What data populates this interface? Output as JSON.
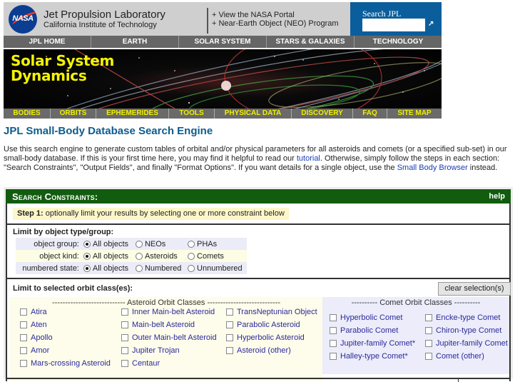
{
  "header": {
    "logo": "NASA",
    "lab_name": "Jet Propulsion Laboratory",
    "lab_sub": "California Institute of Technology",
    "links": [
      "+ View the NASA Portal",
      "+ Near-Earth Object (NEO) Program"
    ],
    "search_label": "Search JPL",
    "search_value": "",
    "search_go_icon": "arrow-go-icon"
  },
  "top_nav": [
    "JPL HOME",
    "EARTH",
    "SOLAR SYSTEM",
    "STARS & GALAXIES",
    "TECHNOLOGY"
  ],
  "banner": {
    "title_line1": "Solar System",
    "title_line2": "Dynamics"
  },
  "sub_nav": [
    "BODIES",
    "ORBITS",
    "EPHEMERIDES",
    "TOOLS",
    "PHYSICAL DATA",
    "DISCOVERY",
    "FAQ",
    "SITE MAP"
  ],
  "page_title": "JPL Small-Body Database Search Engine",
  "intro": {
    "part1": "Use this search engine to generate custom tables of orbital and/or physical parameters for all asteroids and comets (or a specified sub-set) in our small-body database. If this is your first time here, you may find it helpful to read our ",
    "link1": "tutorial",
    "part2": ". Otherwise, simply follow the steps in each section: \"Search Constraints\", \"Output Fields\", and finally \"Format Options\". If you want details for a single object, use the ",
    "link2": "Small Body Browser",
    "part3": " instead."
  },
  "constraints": {
    "title": "Search Constraints:",
    "help": "help",
    "step_label": "Step 1:",
    "step_text": " optionally limit your results by selecting one or more constraint below",
    "group_section": "Limit by object type/group:",
    "groups": [
      {
        "label": "object group:",
        "options": [
          "All objects",
          "NEOs",
          "PHAs"
        ],
        "selected": 0
      },
      {
        "label": "object kind:",
        "options": [
          "All objects",
          "Asteroids",
          "Comets"
        ],
        "selected": 0
      },
      {
        "label": "numbered state:",
        "options": [
          "All objects",
          "Numbered",
          "Unnumbered"
        ],
        "selected": 0
      }
    ],
    "orbit_section": "Limit to selected orbit class(es):",
    "clear_button": "clear selection(s)",
    "asteroid_header": "---------------------------- Asteroid Orbit Classes ----------------------------",
    "asteroid_classes": [
      [
        "Atira",
        "Aten",
        "Apollo",
        "Amor",
        "Mars-crossing Asteroid"
      ],
      [
        "Inner Main-belt Asteroid",
        "Main-belt Asteroid",
        "Outer Main-belt Asteroid",
        "Jupiter Trojan",
        "Centaur"
      ],
      [
        "TransNeptunian Object",
        "Parabolic Asteroid",
        "Hyperbolic Asteroid",
        "Asteroid (other)"
      ]
    ],
    "comet_header": "---------- Comet Orbit Classes ----------",
    "comet_classes": [
      [
        "Hyperbolic Comet",
        "Parabolic Comet",
        "Jupiter-family Comet*",
        "Halley-type Comet*"
      ],
      [
        "Encke-type Comet",
        "Chiron-type Comet",
        "Jupiter-family Comet",
        "Comet (other)"
      ]
    ]
  }
}
